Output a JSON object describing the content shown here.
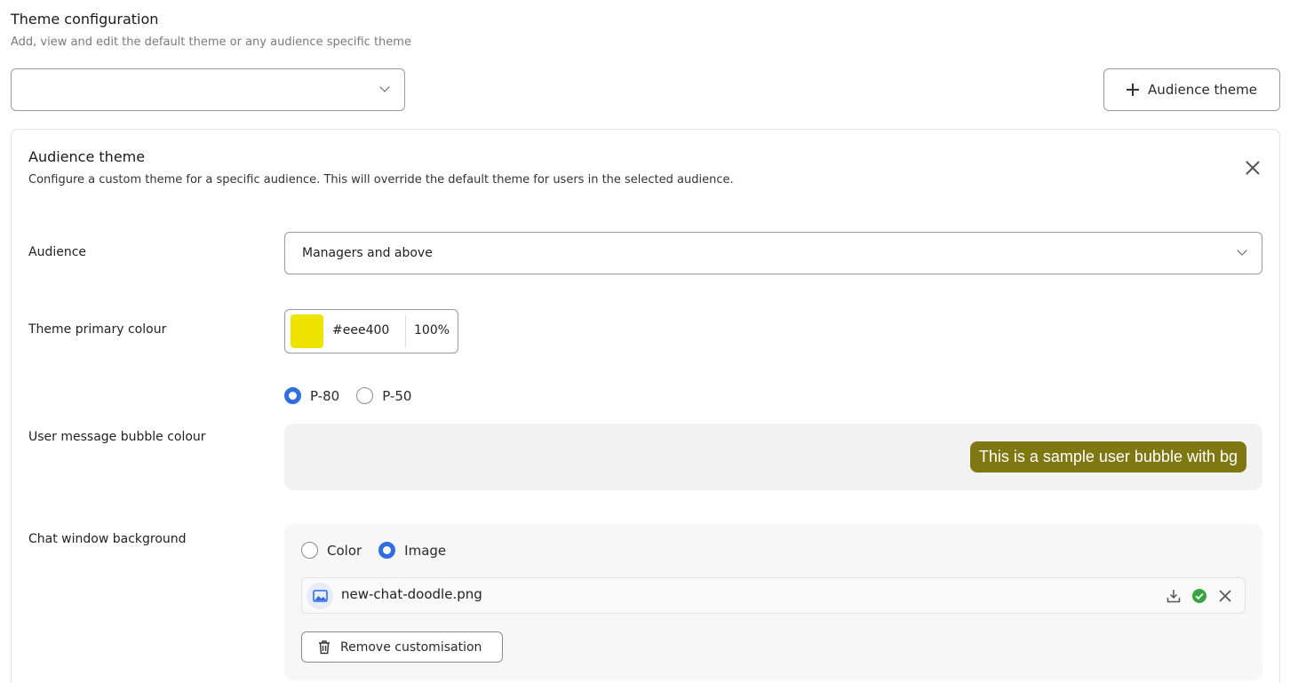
{
  "header": {
    "title": "Theme configuration",
    "subtitle": "Add, view and edit the default theme or any audience specific theme"
  },
  "theme_select": {
    "value": "",
    "icon": "chevron-down-icon"
  },
  "add_button": {
    "label": "Audience theme",
    "icon": "plus-icon"
  },
  "card": {
    "title": "Audience theme",
    "description": "Configure a custom theme for a specific audience. This will override the default theme for users in the selected audience.",
    "close_icon": "close-icon"
  },
  "audience": {
    "label": "Audience",
    "value": "Managers and above",
    "icon": "chevron-down-icon"
  },
  "primary_colour": {
    "label": "Theme primary colour",
    "hex": "#eee400",
    "opacity": "100%",
    "swatch_color": "#eee400"
  },
  "bubble_colour": {
    "label": "User message bubble colour",
    "options": [
      {
        "label": "P-80",
        "selected": true
      },
      {
        "label": "P-50",
        "selected": false
      }
    ],
    "sample_text": "This is a sample user bubble with bg",
    "bubble_color": "#7e7712",
    "preview_bg": "#f2f2f2"
  },
  "chat_background": {
    "label": "Chat window background",
    "options": [
      {
        "label": "Color",
        "selected": false
      },
      {
        "label": "Image",
        "selected": true
      }
    ],
    "file": {
      "name": "new-chat-doodle.png",
      "icon": "image-icon",
      "actions": [
        "download-icon",
        "check-circle-icon",
        "close-icon"
      ],
      "status_color": "#3aa53f"
    },
    "remove_label": "Remove customisation",
    "remove_icon": "trash-icon"
  },
  "colors": {
    "accent": "#2f6de1"
  }
}
